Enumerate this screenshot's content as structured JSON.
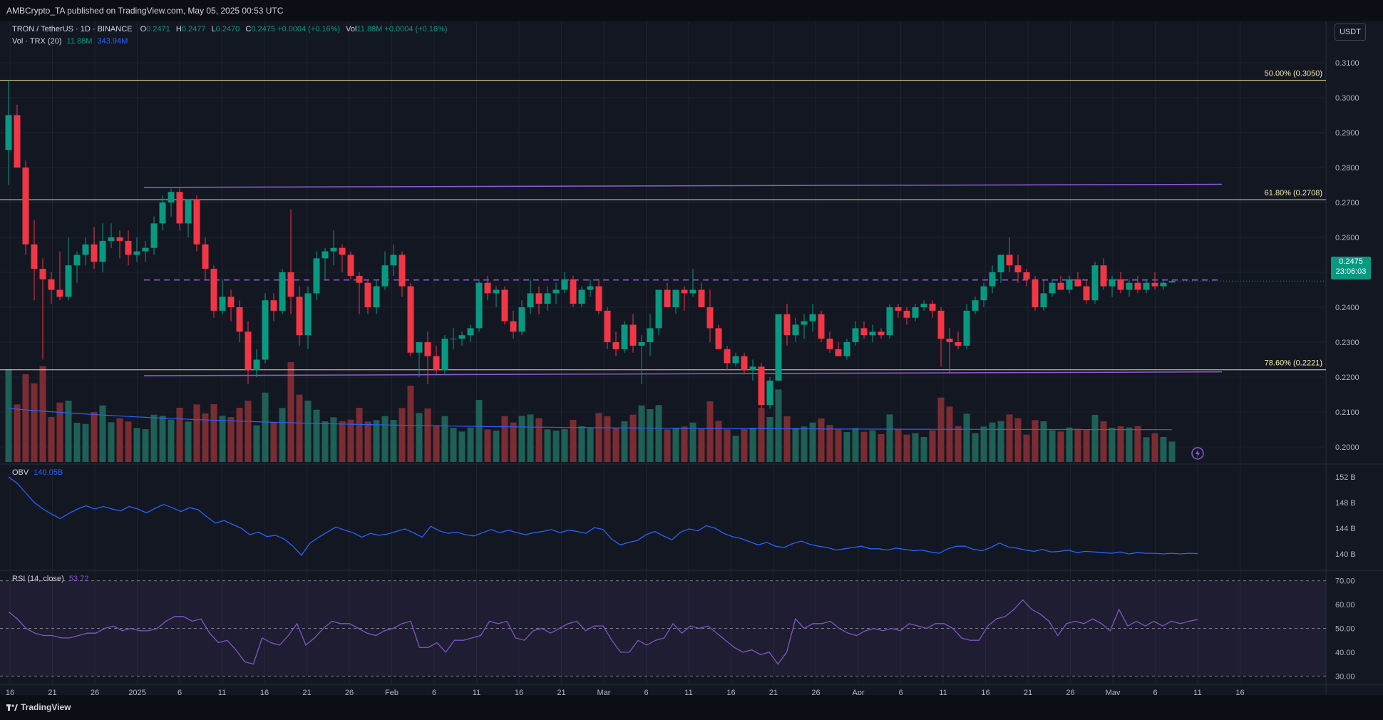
{
  "header": {
    "published": "AMBCrypto_TA published on TradingView.com, May 05, 2025 00:53 UTC"
  },
  "legend": {
    "symbol": "TRON / TetherUS · 1D · BINANCE",
    "o_label": "O",
    "o": "0.2471",
    "h_label": "H",
    "h": "0.2477",
    "l_label": "L",
    "l": "0.2470",
    "c_label": "C",
    "c": "0.2475",
    "change": "+0.0004 (+0.16%)",
    "vol_label": "Vol",
    "vol": "11.88M",
    "vol_change": "+0.0004 (+0.16%)",
    "vol_row_label": "Vol · TRX (20)",
    "vol_value": "11.88M",
    "vol_ma": "343.94M"
  },
  "currency_button": "USDT",
  "last_price": {
    "value": "0.2475",
    "countdown": "23:06:03"
  },
  "branding": "TradingView",
  "colors": {
    "background": "#131722",
    "up": "#089981",
    "down": "#f23645",
    "vol_up": "#1e5f56",
    "vol_down": "#7a2c32",
    "fib": "#e8dd92",
    "channel": "#8c5ed6",
    "obv": "#2962ff",
    "rsi": "#7e57c2",
    "vol_ma": "#2962ff"
  },
  "chart_data": [
    {
      "type": "candlestick",
      "price_axis": [
        "0.3100",
        "0.3000",
        "0.2900",
        "0.2800",
        "0.2700",
        "0.2600",
        "0.2500",
        "0.2400",
        "0.2300",
        "0.2200",
        "0.2100",
        "0.2000"
      ],
      "x_axis_labels": [
        "16",
        "21",
        "26",
        "2025",
        "6",
        "11",
        "16",
        "21",
        "26",
        "Feb",
        "6",
        "11",
        "16",
        "21",
        "Mar",
        "6",
        "11",
        "16",
        "21",
        "26",
        "Apr",
        "6",
        "11",
        "16",
        "21",
        "26",
        "May",
        "6",
        "11",
        "16"
      ],
      "fib_levels": [
        {
          "label": "50.00% (0.3050)",
          "price": 0.305
        },
        {
          "label": "61.80% (0.2708)",
          "price": 0.2708
        },
        {
          "label": "78.60% (0.2221)",
          "price": 0.2221
        }
      ],
      "channel": {
        "top": [
          0.2743,
          0.2752
        ],
        "bottom": [
          0.2204,
          0.2215
        ],
        "mid": 0.2478
      },
      "candles": [
        [
          0.285,
          0.305,
          0.275,
          0.295
        ],
        [
          0.295,
          0.298,
          0.282,
          0.28
        ],
        [
          0.28,
          0.282,
          0.255,
          0.258
        ],
        [
          0.258,
          0.265,
          0.242,
          0.251
        ],
        [
          0.251,
          0.254,
          0.225,
          0.248
        ],
        [
          0.248,
          0.25,
          0.241,
          0.245
        ],
        [
          0.245,
          0.256,
          0.242,
          0.243
        ],
        [
          0.243,
          0.26,
          0.242,
          0.252
        ],
        [
          0.252,
          0.256,
          0.247,
          0.255
        ],
        [
          0.255,
          0.26,
          0.252,
          0.258
        ],
        [
          0.258,
          0.263,
          0.251,
          0.253
        ],
        [
          0.253,
          0.264,
          0.25,
          0.259
        ],
        [
          0.259,
          0.264,
          0.257,
          0.26
        ],
        [
          0.26,
          0.262,
          0.254,
          0.259
        ],
        [
          0.259,
          0.262,
          0.252,
          0.255
        ],
        [
          0.255,
          0.26,
          0.253,
          0.256
        ],
        [
          0.256,
          0.259,
          0.253,
          0.257
        ],
        [
          0.257,
          0.266,
          0.255,
          0.264
        ],
        [
          0.264,
          0.272,
          0.262,
          0.27
        ],
        [
          0.27,
          0.274,
          0.266,
          0.273
        ],
        [
          0.273,
          0.274,
          0.262,
          0.264
        ],
        [
          0.264,
          0.27,
          0.26,
          0.271
        ],
        [
          0.271,
          0.272,
          0.256,
          0.258
        ],
        [
          0.258,
          0.26,
          0.248,
          0.251
        ],
        [
          0.251,
          0.252,
          0.237,
          0.239
        ],
        [
          0.239,
          0.248,
          0.238,
          0.243
        ],
        [
          0.243,
          0.245,
          0.236,
          0.24
        ],
        [
          0.24,
          0.242,
          0.23,
          0.233
        ],
        [
          0.233,
          0.236,
          0.218,
          0.222
        ],
        [
          0.222,
          0.228,
          0.22,
          0.225
        ],
        [
          0.225,
          0.244,
          0.224,
          0.242
        ],
        [
          0.242,
          0.244,
          0.236,
          0.239
        ],
        [
          0.239,
          0.251,
          0.238,
          0.25
        ],
        [
          0.25,
          0.268,
          0.238,
          0.243
        ],
        [
          0.243,
          0.246,
          0.229,
          0.232
        ],
        [
          0.232,
          0.246,
          0.228,
          0.244
        ],
        [
          0.244,
          0.256,
          0.242,
          0.254
        ],
        [
          0.254,
          0.257,
          0.248,
          0.256
        ],
        [
          0.256,
          0.262,
          0.252,
          0.257
        ],
        [
          0.257,
          0.258,
          0.25,
          0.255
        ],
        [
          0.255,
          0.256,
          0.248,
          0.249
        ],
        [
          0.249,
          0.25,
          0.238,
          0.247
        ],
        [
          0.247,
          0.248,
          0.238,
          0.24
        ],
        [
          0.24,
          0.248,
          0.238,
          0.246
        ],
        [
          0.246,
          0.256,
          0.245,
          0.252
        ],
        [
          0.252,
          0.258,
          0.249,
          0.255
        ],
        [
          0.255,
          0.256,
          0.243,
          0.246
        ],
        [
          0.246,
          0.247,
          0.226,
          0.227
        ],
        [
          0.227,
          0.23,
          0.22,
          0.23
        ],
        [
          0.23,
          0.233,
          0.218,
          0.226
        ],
        [
          0.226,
          0.229,
          0.221,
          0.222
        ],
        [
          0.222,
          0.232,
          0.221,
          0.231
        ],
        [
          0.231,
          0.234,
          0.228,
          0.231
        ],
        [
          0.231,
          0.233,
          0.229,
          0.232
        ],
        [
          0.232,
          0.235,
          0.23,
          0.234
        ],
        [
          0.234,
          0.248,
          0.233,
          0.247
        ],
        [
          0.247,
          0.249,
          0.242,
          0.244
        ],
        [
          0.244,
          0.246,
          0.24,
          0.245
        ],
        [
          0.245,
          0.246,
          0.235,
          0.236
        ],
        [
          0.236,
          0.239,
          0.231,
          0.233
        ],
        [
          0.233,
          0.242,
          0.232,
          0.24
        ],
        [
          0.24,
          0.248,
          0.238,
          0.244
        ],
        [
          0.244,
          0.246,
          0.238,
          0.241
        ],
        [
          0.241,
          0.246,
          0.239,
          0.244
        ],
        [
          0.244,
          0.247,
          0.241,
          0.245
        ],
        [
          0.245,
          0.25,
          0.244,
          0.248
        ],
        [
          0.248,
          0.249,
          0.24,
          0.241
        ],
        [
          0.241,
          0.246,
          0.24,
          0.245
        ],
        [
          0.245,
          0.248,
          0.243,
          0.246
        ],
        [
          0.246,
          0.248,
          0.238,
          0.239
        ],
        [
          0.239,
          0.24,
          0.228,
          0.23
        ],
        [
          0.23,
          0.233,
          0.226,
          0.228
        ],
        [
          0.228,
          0.236,
          0.227,
          0.235
        ],
        [
          0.235,
          0.238,
          0.227,
          0.229
        ],
        [
          0.229,
          0.232,
          0.218,
          0.23
        ],
        [
          0.23,
          0.238,
          0.226,
          0.234
        ],
        [
          0.234,
          0.245,
          0.232,
          0.245
        ],
        [
          0.245,
          0.247,
          0.24,
          0.24
        ],
        [
          0.24,
          0.245,
          0.238,
          0.245
        ],
        [
          0.245,
          0.246,
          0.239,
          0.244
        ],
        [
          0.244,
          0.251,
          0.243,
          0.245
        ],
        [
          0.245,
          0.247,
          0.242,
          0.24
        ],
        [
          0.24,
          0.245,
          0.23,
          0.234
        ],
        [
          0.234,
          0.235,
          0.228,
          0.228
        ],
        [
          0.228,
          0.229,
          0.222,
          0.224
        ],
        [
          0.224,
          0.227,
          0.223,
          0.226
        ],
        [
          0.226,
          0.227,
          0.221,
          0.222
        ],
        [
          0.222,
          0.225,
          0.219,
          0.223
        ],
        [
          0.223,
          0.224,
          0.211,
          0.212
        ],
        [
          0.212,
          0.22,
          0.211,
          0.219
        ],
        [
          0.219,
          0.238,
          0.219,
          0.238
        ],
        [
          0.238,
          0.241,
          0.229,
          0.232
        ],
        [
          0.232,
          0.237,
          0.23,
          0.235
        ],
        [
          0.235,
          0.238,
          0.231,
          0.236
        ],
        [
          0.236,
          0.241,
          0.233,
          0.238
        ],
        [
          0.238,
          0.239,
          0.23,
          0.231
        ],
        [
          0.231,
          0.233,
          0.227,
          0.228
        ],
        [
          0.228,
          0.23,
          0.226,
          0.226
        ],
        [
          0.226,
          0.231,
          0.225,
          0.23
        ],
        [
          0.23,
          0.236,
          0.229,
          0.234
        ],
        [
          0.234,
          0.236,
          0.231,
          0.232
        ],
        [
          0.232,
          0.235,
          0.23,
          0.233
        ],
        [
          0.233,
          0.234,
          0.231,
          0.232
        ],
        [
          0.232,
          0.241,
          0.231,
          0.24
        ],
        [
          0.24,
          0.241,
          0.237,
          0.239
        ],
        [
          0.239,
          0.24,
          0.235,
          0.237
        ],
        [
          0.237,
          0.241,
          0.236,
          0.24
        ],
        [
          0.24,
          0.242,
          0.239,
          0.241
        ],
        [
          0.241,
          0.242,
          0.237,
          0.239
        ],
        [
          0.239,
          0.24,
          0.223,
          0.231
        ],
        [
          0.231,
          0.234,
          0.221,
          0.23
        ],
        [
          0.23,
          0.233,
          0.228,
          0.229
        ],
        [
          0.229,
          0.241,
          0.228,
          0.239
        ],
        [
          0.239,
          0.243,
          0.238,
          0.242
        ],
        [
          0.242,
          0.247,
          0.24,
          0.246
        ],
        [
          0.246,
          0.252,
          0.244,
          0.25
        ],
        [
          0.25,
          0.255,
          0.247,
          0.255
        ],
        [
          0.255,
          0.26,
          0.25,
          0.252
        ],
        [
          0.252,
          0.255,
          0.247,
          0.25
        ],
        [
          0.25,
          0.251,
          0.246,
          0.248
        ],
        [
          0.248,
          0.249,
          0.239,
          0.24
        ],
        [
          0.24,
          0.248,
          0.239,
          0.244
        ],
        [
          0.244,
          0.248,
          0.243,
          0.247
        ],
        [
          0.247,
          0.249,
          0.245,
          0.245
        ],
        [
          0.245,
          0.249,
          0.244,
          0.248
        ],
        [
          0.248,
          0.25,
          0.246,
          0.246
        ],
        [
          0.246,
          0.248,
          0.241,
          0.242
        ],
        [
          0.242,
          0.253,
          0.241,
          0.252
        ],
        [
          0.252,
          0.254,
          0.245,
          0.246
        ],
        [
          0.246,
          0.249,
          0.243,
          0.248
        ],
        [
          0.248,
          0.25,
          0.244,
          0.245
        ],
        [
          0.245,
          0.248,
          0.243,
          0.247
        ],
        [
          0.247,
          0.249,
          0.244,
          0.245
        ],
        [
          0.245,
          0.248,
          0.244,
          0.247
        ],
        [
          0.247,
          0.25,
          0.245,
          0.246
        ],
        [
          0.246,
          0.248,
          0.245,
          0.247
        ],
        [
          0.2471,
          0.2477,
          0.247,
          0.2475
        ]
      ],
      "volume_axis": [],
      "indicator_vol_ma": "343.94M"
    },
    {
      "type": "line",
      "name": "OBV",
      "label": "OBV",
      "value_label": "140.05B",
      "y_axis": [
        "152 B",
        "148 B",
        "144 B",
        "140 B"
      ],
      "ylim": [
        138,
        153
      ],
      "values": [
        152.0,
        151.0,
        149.5,
        148.0,
        147.0,
        146.2,
        145.5,
        146.3,
        147.0,
        147.5,
        147.0,
        147.4,
        147.0,
        146.7,
        147.4,
        147.0,
        146.4,
        147.1,
        147.7,
        147.2,
        146.6,
        147.2,
        146.9,
        145.8,
        144.8,
        145.2,
        144.6,
        144.0,
        143.0,
        143.4,
        142.7,
        142.9,
        142.3,
        141.2,
        139.8,
        141.7,
        142.6,
        143.4,
        144.2,
        143.7,
        143.3,
        142.6,
        143.2,
        142.9,
        143.1,
        143.5,
        143.9,
        143.3,
        142.6,
        144.3,
        143.6,
        143.2,
        143.4,
        143.0,
        142.8,
        143.3,
        143.8,
        143.3,
        143.7,
        143.3,
        143.0,
        143.3,
        143.5,
        143.8,
        143.3,
        143.7,
        143.5,
        143.2,
        144.1,
        143.8,
        142.3,
        141.4,
        141.8,
        142.1,
        143.0,
        143.5,
        142.8,
        142.2,
        143.4,
        143.9,
        143.6,
        144.4,
        144.0,
        143.2,
        142.7,
        142.4,
        141.9,
        141.4,
        141.8,
        141.2,
        141.0,
        141.6,
        142.0,
        141.5,
        141.2,
        141.0,
        140.6,
        140.8,
        141.0,
        141.2,
        140.8,
        140.8,
        140.6,
        140.9,
        140.7,
        140.5,
        140.6,
        140.3,
        140.1,
        140.8,
        141.2,
        141.2,
        140.7,
        140.5,
        141.0,
        141.7,
        141.1,
        140.9,
        140.6,
        140.4,
        140.7,
        140.3,
        140.4,
        140.6,
        140.2,
        140.4,
        140.3,
        140.2,
        140.1,
        140.3,
        140.0,
        140.2,
        140.1,
        140.1,
        140.0,
        140.1,
        140.0,
        140.1,
        140.05
      ]
    },
    {
      "type": "line",
      "name": "RSI (14, close)",
      "label": "RSI (14, close)",
      "value_label": "53.72",
      "y_axis": [
        "70.00",
        "60.00",
        "50.00",
        "40.00",
        "30.00"
      ],
      "bands": [
        70,
        50,
        30
      ],
      "ylim": [
        28,
        72
      ],
      "values": [
        57,
        54,
        50,
        48,
        47,
        47,
        46,
        46,
        47,
        48,
        48,
        50,
        51,
        49,
        50,
        49,
        49,
        50,
        53,
        55,
        55,
        53,
        54,
        48,
        44,
        45,
        41,
        36,
        35,
        46,
        44,
        43,
        47,
        52,
        43,
        46,
        50,
        53,
        52,
        52,
        50,
        48,
        47,
        49,
        50,
        52,
        53,
        42,
        42,
        44,
        40,
        45,
        45,
        46,
        47,
        53,
        52,
        53,
        46,
        45,
        49,
        50,
        48,
        50,
        52,
        53,
        49,
        51,
        51,
        45,
        40,
        40,
        45,
        43,
        45,
        46,
        52,
        48,
        51,
        50,
        51,
        48,
        45,
        42,
        40,
        41,
        39,
        40,
        35,
        40,
        54,
        50,
        52,
        52,
        53,
        50,
        48,
        47,
        49,
        50,
        49,
        50,
        49,
        52,
        51,
        50,
        52,
        52,
        50,
        46,
        45,
        45,
        51,
        54,
        55,
        58,
        62,
        58,
        56,
        53,
        47,
        52,
        53,
        52,
        54,
        52,
        49,
        58,
        51,
        53,
        51,
        53,
        51,
        53,
        52,
        53,
        53.72
      ]
    }
  ]
}
